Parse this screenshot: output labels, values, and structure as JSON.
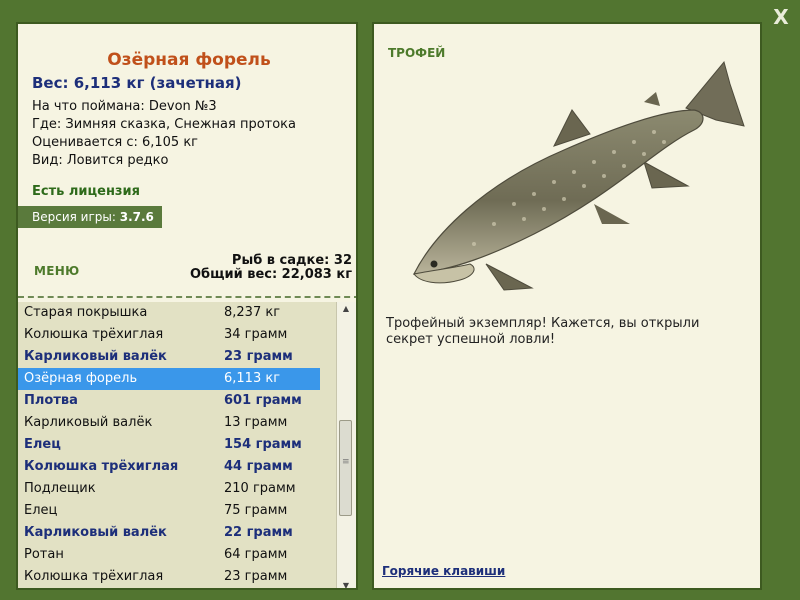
{
  "left": {
    "fish_name": "Озёрная форель",
    "weight": "Вес: 6,113 кг (зачетная)",
    "info": [
      "На что поймана: Devon №3",
      "Где: Зимняя сказка, Снежная протока",
      "Оценивается с: 6,105 кг",
      "Вид: Ловится редко"
    ],
    "license": "Есть лицензия",
    "version_label": "Версия игры:",
    "version_value": "3.7.6",
    "menu": "МЕНЮ",
    "fish_in_cage": "Рыб в садке: 32",
    "total_weight": "Общий вес: 22,083 кг"
  },
  "list": [
    {
      "name": "Старая покрышка",
      "weight": "8,237 кг",
      "style": "normal"
    },
    {
      "name": "Колюшка трёхиглая",
      "weight": "34 грамм",
      "style": "normal"
    },
    {
      "name": "Карликовый валёк",
      "weight": "23 грамм",
      "style": "bold"
    },
    {
      "name": "Озёрная форель",
      "weight": "6,113 кг",
      "style": "selected"
    },
    {
      "name": "Плотва",
      "weight": "601 грамм",
      "style": "bold"
    },
    {
      "name": "Карликовый валёк",
      "weight": "13 грамм",
      "style": "normal"
    },
    {
      "name": "Елец",
      "weight": "154 грамм",
      "style": "bold"
    },
    {
      "name": "Колюшка трёхиглая",
      "weight": "44 грамм",
      "style": "bold"
    },
    {
      "name": "Подлещик",
      "weight": "210 грамм",
      "style": "normal"
    },
    {
      "name": "Елец",
      "weight": "75 грамм",
      "style": "normal"
    },
    {
      "name": "Карликовый валёк",
      "weight": "22 грамм",
      "style": "bold"
    },
    {
      "name": "Ротан",
      "weight": "64 грамм",
      "style": "normal"
    },
    {
      "name": "Колюшка трёхиглая",
      "weight": "23 грамм",
      "style": "normal"
    }
  ],
  "right": {
    "trophy": "ТРОФЕЙ",
    "description": "Трофейный экземпляр! Кажется, вы открыли секрет успешной ловли!",
    "hotkeys": "Горячие клавиши"
  },
  "window": {
    "close": "X"
  },
  "colors": {
    "frame": "#527530",
    "panel": "#f6f4e2",
    "title_orange": "#c0501a",
    "bold_blue": "#1d2f7a",
    "selection": "#3a97ea",
    "list_bg": "#e2e1c4"
  },
  "icons": {
    "close": "close-icon",
    "scroll_up": "arrow-up-icon",
    "scroll_down": "arrow-down-icon",
    "trophy_fish": "lake-trout-image"
  }
}
